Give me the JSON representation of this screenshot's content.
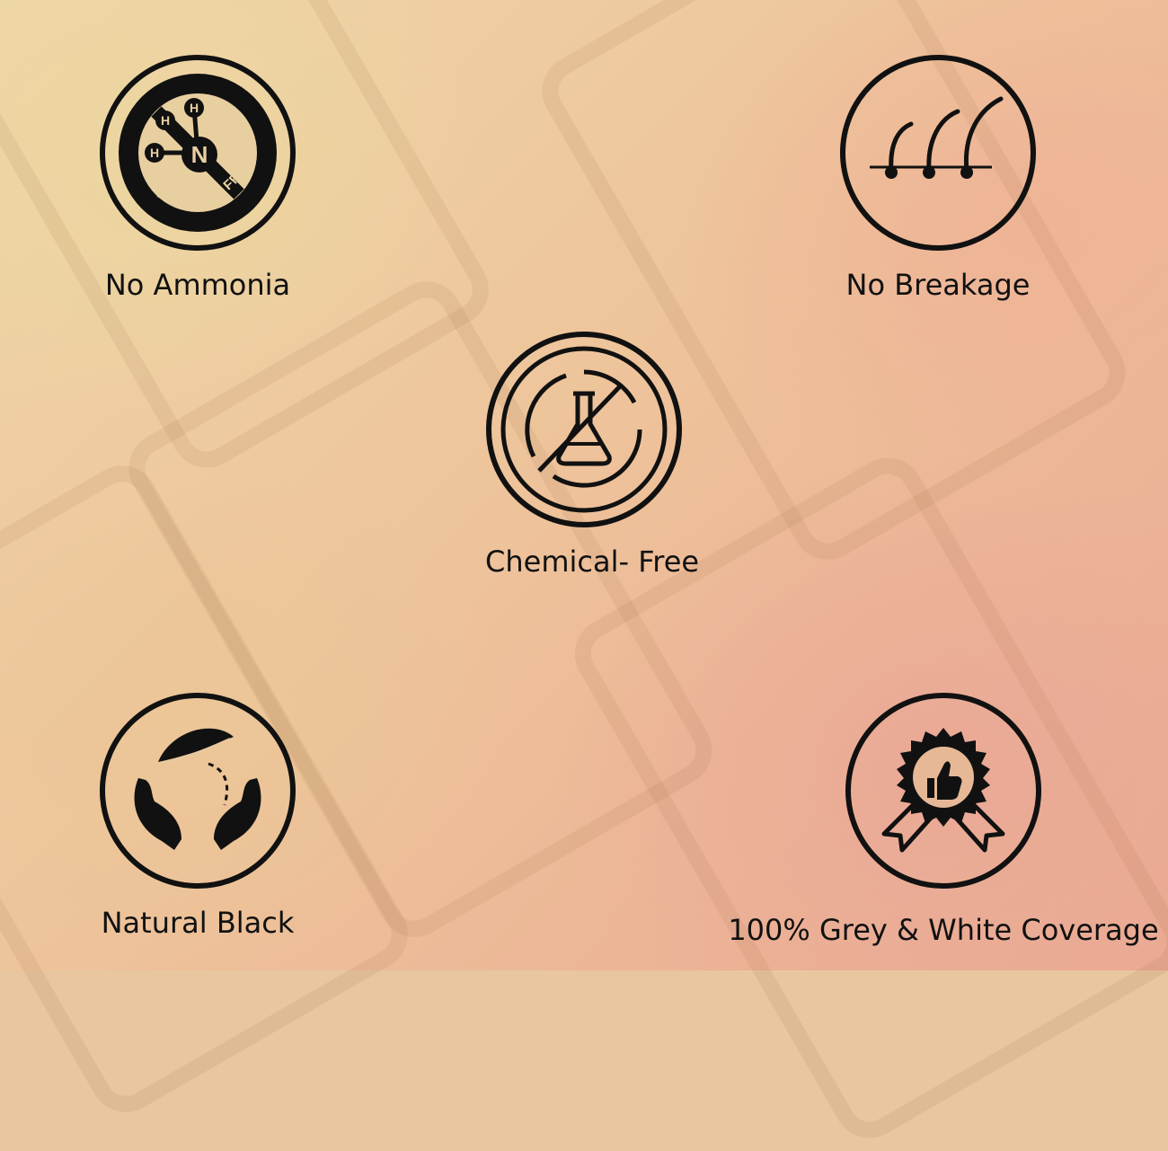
{
  "features": [
    {
      "label": "No Ammonia",
      "icon": "ammonia-free-icon",
      "icon_text": {
        "h": "H",
        "n": "N",
        "badge": "AMMONIA FREE"
      }
    },
    {
      "label": "No Breakage",
      "icon": "hair-strands-icon"
    },
    {
      "label": "Chemical- Free",
      "icon": "no-chemical-flask-icon"
    },
    {
      "label": "Natural Black",
      "icon": "leaf-hands-icon"
    },
    {
      "label": "100% Grey & White Coverage",
      "icon": "thumbs-up-badge-icon"
    }
  ],
  "colors": {
    "icon_stroke": "#111111",
    "label_text": "#111111"
  }
}
